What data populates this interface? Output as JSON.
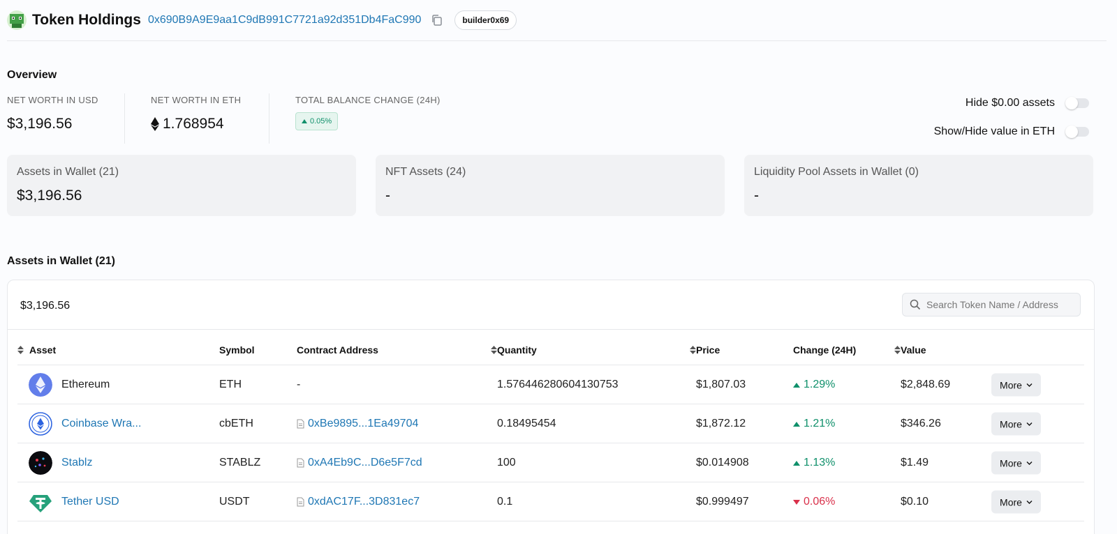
{
  "header": {
    "title": "Token Holdings",
    "address": "0x690B9A9E9aa1C9dB991C7721a92d351Db4FaC990",
    "tag": "builder0x69"
  },
  "overview": {
    "title": "Overview",
    "net_worth_usd_label": "NET WORTH IN USD",
    "net_worth_usd": "$3,196.56",
    "net_worth_eth_label": "NET WORTH IN ETH",
    "net_worth_eth": "1.768954",
    "balance_change_label": "TOTAL BALANCE CHANGE (24H)",
    "balance_change": "0.05%",
    "hide_zero_label": "Hide $0.00 assets",
    "show_eth_label": "Show/Hide value in ETH"
  },
  "cards": [
    {
      "title": "Assets in Wallet (21)",
      "value": "$3,196.56"
    },
    {
      "title": "NFT Assets (24)",
      "value": "-"
    },
    {
      "title": "Liquidity Pool Assets in Wallet (0)",
      "value": "-"
    }
  ],
  "assets": {
    "title": "Assets in Wallet (21)",
    "total": "$3,196.56",
    "search_placeholder": "Search Token Name / Address",
    "columns": {
      "asset": "Asset",
      "symbol": "Symbol",
      "contract": "Contract Address",
      "quantity": "Quantity",
      "price": "Price",
      "change": "Change (24H)",
      "value": "Value"
    },
    "rows": [
      {
        "name": "Ethereum",
        "symbol": "ETH",
        "contract": "-",
        "quantity": "1.576446280604130753",
        "price": "$1,807.03",
        "change": "1.29%",
        "direction": "up",
        "value": "$2,848.69",
        "more": "More",
        "icon": "ethereum-icon"
      },
      {
        "name": "Coinbase Wra...",
        "symbol": "cbETH",
        "contract": "0xBe9895...1Ea49704",
        "quantity": "0.18495454",
        "price": "$1,872.12",
        "change": "1.21%",
        "direction": "up",
        "value": "$346.26",
        "more": "More",
        "icon": "cbeth-icon"
      },
      {
        "name": "Stablz",
        "symbol": "STABLZ",
        "contract": "0xA4Eb9C...D6e5F7cd",
        "quantity": "100",
        "price": "$0.014908",
        "change": "1.13%",
        "direction": "up",
        "value": "$1.49",
        "more": "More",
        "icon": "stablz-icon"
      },
      {
        "name": "Tether USD",
        "symbol": "USDT",
        "contract": "0xdAC17F...3D831ec7",
        "quantity": "0.1",
        "price": "$0.999497",
        "change": "0.06%",
        "direction": "down",
        "value": "$0.10",
        "more": "More",
        "icon": "tether-icon"
      }
    ]
  },
  "colors": {
    "link": "#1f77b4",
    "positive": "#10906b",
    "negative": "#d9304a"
  }
}
